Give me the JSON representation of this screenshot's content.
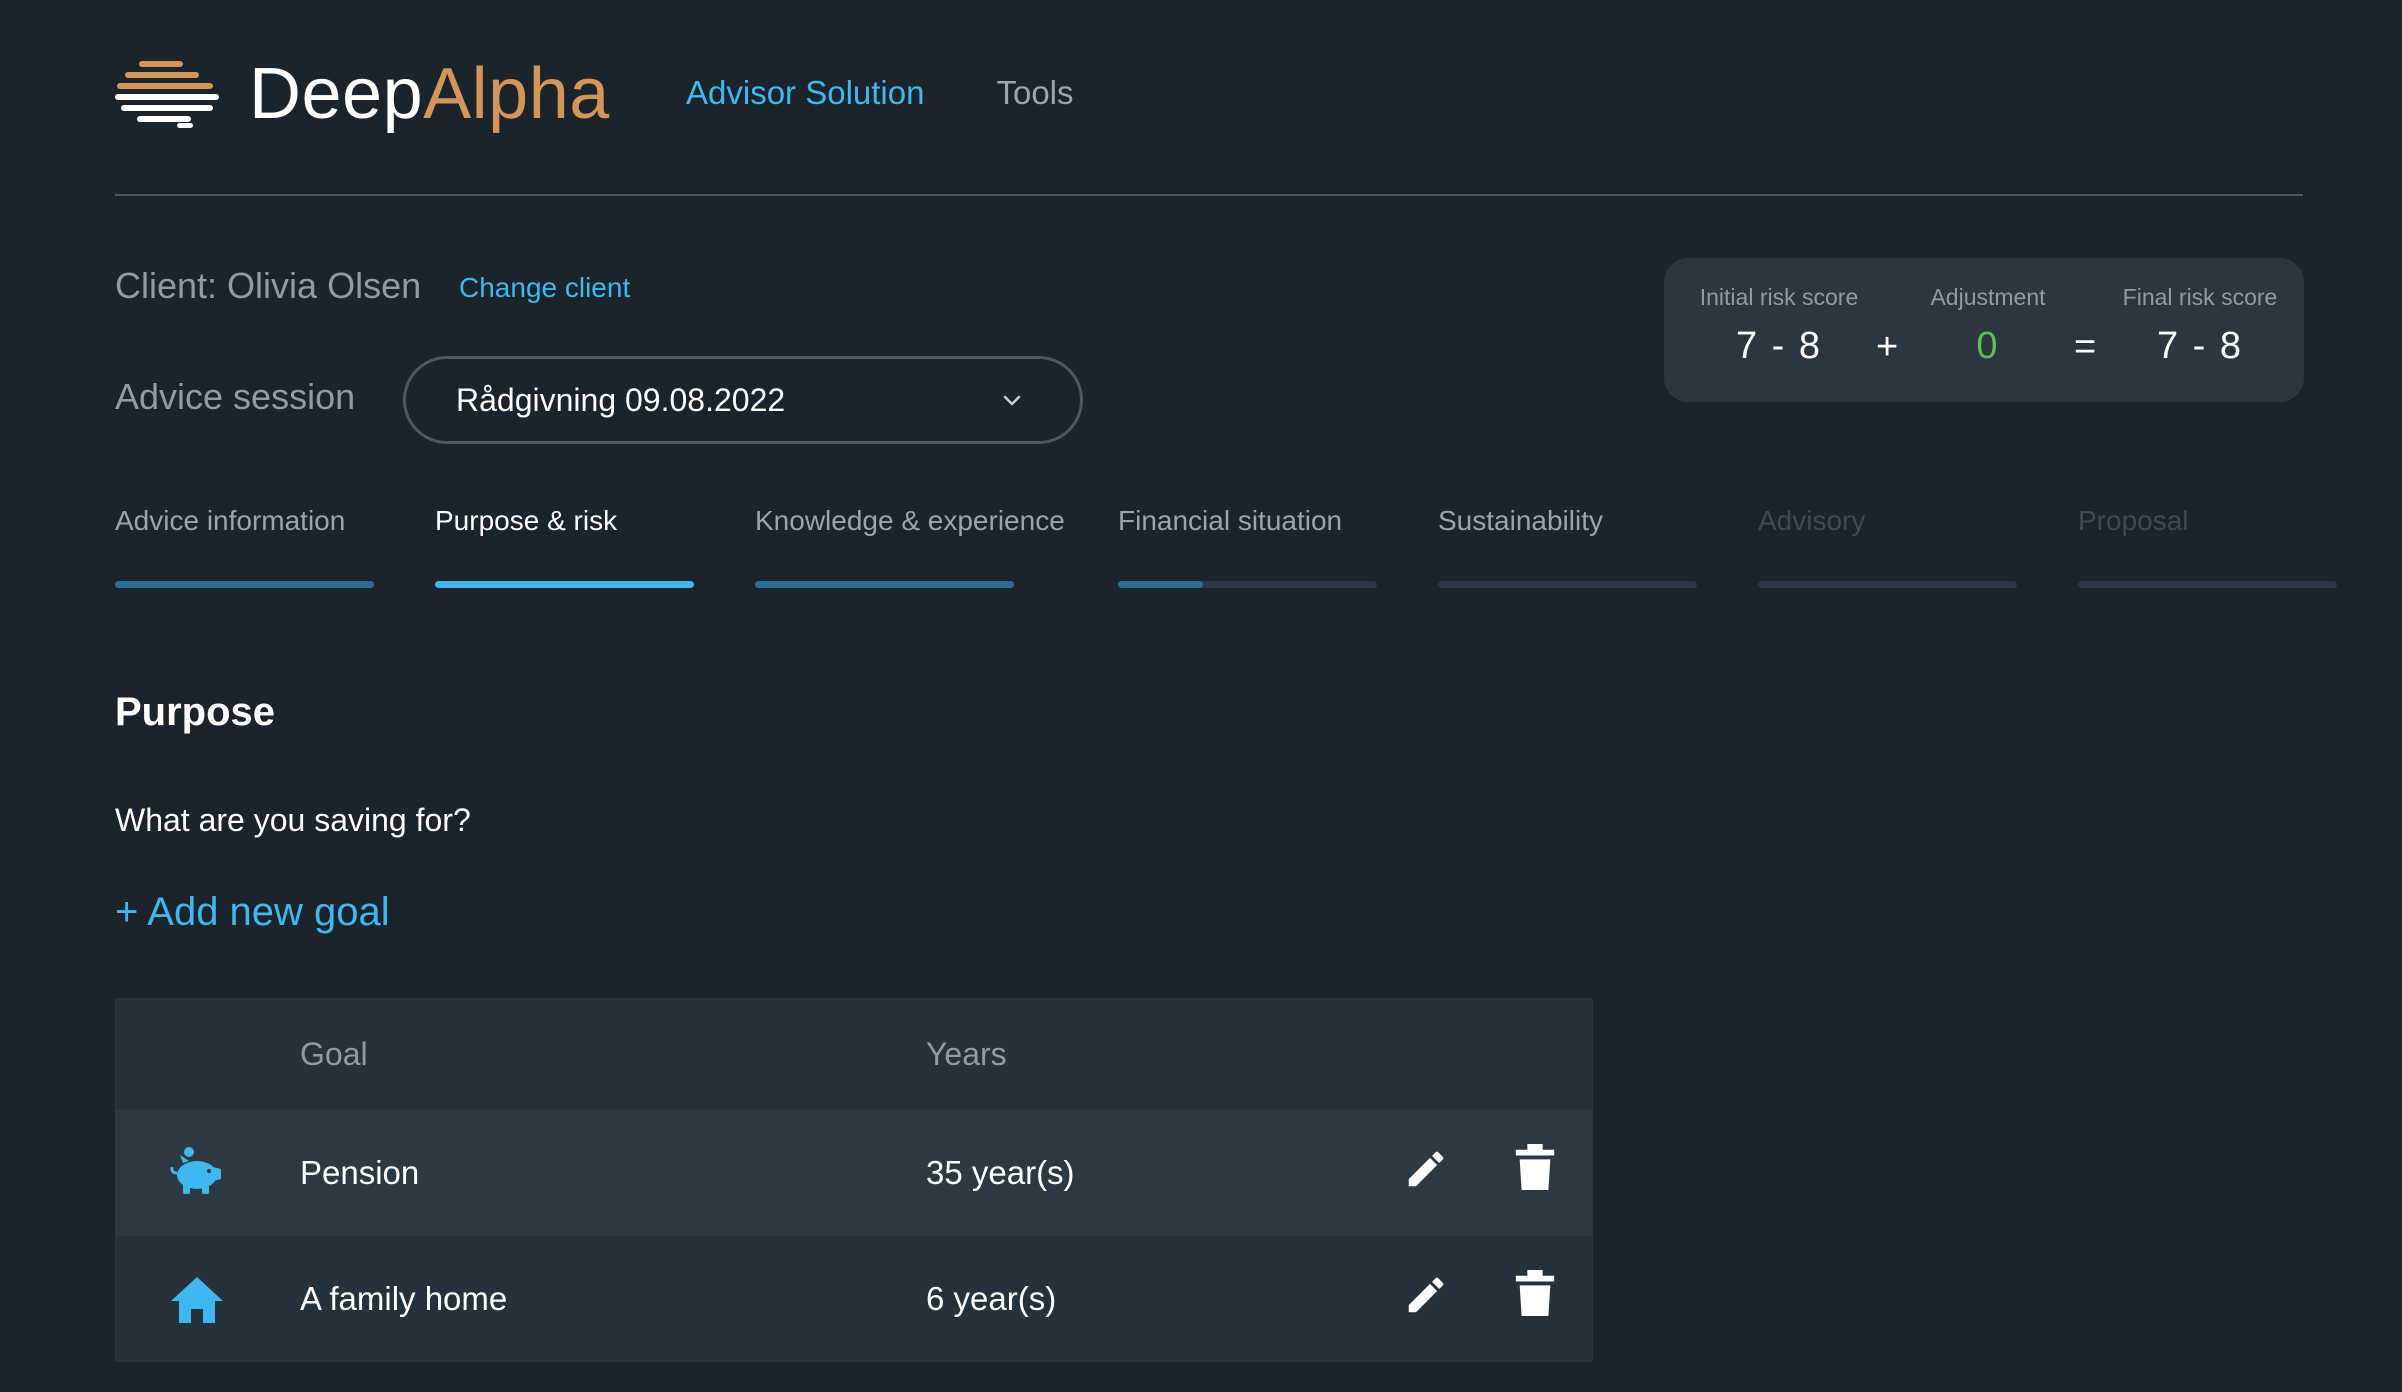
{
  "header": {
    "logo": {
      "part1": "Deep",
      "part2": "Alpha",
      "icon": "deepalpha-logo-icon"
    },
    "nav": [
      {
        "label": "Advisor Solution",
        "active": true
      },
      {
        "label": "Tools",
        "active": false
      }
    ]
  },
  "client": {
    "label": "Client: Olivia Olsen",
    "change_label": "Change client"
  },
  "session": {
    "label": "Advice session",
    "selected": "Rådgivning 09.08.2022",
    "icon": "chevron-down-icon"
  },
  "risk": {
    "initial_label": "Initial risk score",
    "initial_value": "7 - 8",
    "plus": "+",
    "adjustment_label": "Adjustment",
    "adjustment_value": "0",
    "equals": "=",
    "final_label": "Final risk score",
    "final_value": "7 - 8",
    "adjustment_color": "#5bbf59"
  },
  "tabs": [
    {
      "label": "Advice information",
      "progress": 1.0,
      "state": "done"
    },
    {
      "label": "Purpose & risk",
      "progress": 1.0,
      "state": "current"
    },
    {
      "label": "Knowledge & experience",
      "progress": 1.0,
      "state": "done"
    },
    {
      "label": "Financial situation",
      "progress": 0.33,
      "state": "partial"
    },
    {
      "label": "Sustainability",
      "progress": 0,
      "state": "todo"
    },
    {
      "label": "Advisory",
      "progress": 0,
      "state": "disabled"
    },
    {
      "label": "Proposal",
      "progress": 0,
      "state": "disabled"
    }
  ],
  "purpose": {
    "title": "Purpose",
    "question": "What are you saving for?",
    "add_goal": "+ Add new goal"
  },
  "table": {
    "headers": {
      "goal": "Goal",
      "years": "Years"
    },
    "rows": [
      {
        "icon": "piggy-bank-icon",
        "goal": "Pension",
        "years": "35 year(s)"
      },
      {
        "icon": "home-icon",
        "goal": "A family home",
        "years": "6 year(s)"
      }
    ]
  },
  "colors": {
    "accent": "#3fb7ef",
    "brand_orange": "#d4955b",
    "background": "#1b232b",
    "green": "#5bbf59"
  }
}
